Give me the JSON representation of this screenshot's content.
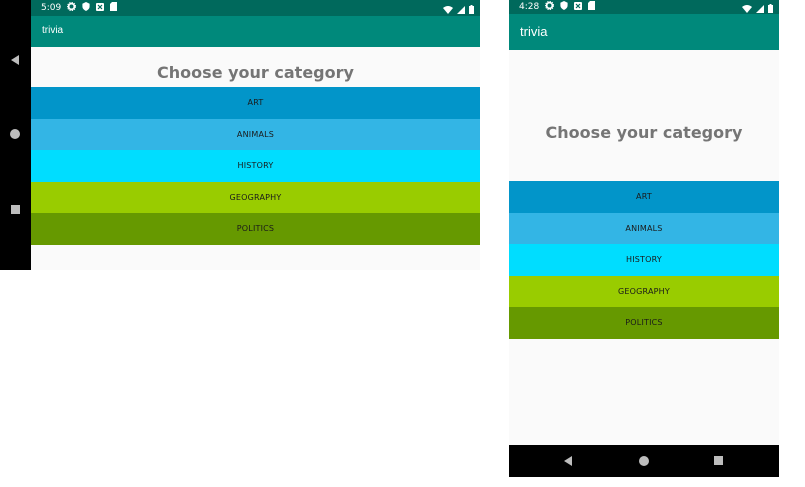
{
  "landscape": {
    "status": {
      "time": "5:09"
    },
    "app_title": "trivia",
    "heading": "Choose your category",
    "categories": [
      {
        "label": "ART",
        "color": "#0295c9"
      },
      {
        "label": "ANIMALS",
        "color": "#33b5e5"
      },
      {
        "label": "HISTORY",
        "color": "#00ddff"
      },
      {
        "label": "GEOGRAPHY",
        "color": "#99cc00"
      },
      {
        "label": "POLITICS",
        "color": "#669900"
      }
    ]
  },
  "portrait": {
    "status": {
      "time": "4:28"
    },
    "app_title": "trivia",
    "heading": "Choose your category",
    "categories": [
      {
        "label": "ART",
        "color": "#0295c9"
      },
      {
        "label": "ANIMALS",
        "color": "#33b5e5"
      },
      {
        "label": "HISTORY",
        "color": "#00ddff"
      },
      {
        "label": "GEOGRAPHY",
        "color": "#99cc00"
      },
      {
        "label": "POLITICS",
        "color": "#669900"
      }
    ]
  },
  "colors": {
    "status_bar": "#00695c",
    "app_bar": "#00897b",
    "background": "#fafafa",
    "heading_text": "#757575",
    "nav_bar": "#000000"
  },
  "icons": {
    "status_left": [
      "settings-icon",
      "shield-icon",
      "notification-icon",
      "sd-card-icon"
    ],
    "status_right": [
      "wifi-icon",
      "signal-icon",
      "battery-icon"
    ],
    "nav": [
      "back-icon",
      "home-icon",
      "recents-icon"
    ]
  }
}
